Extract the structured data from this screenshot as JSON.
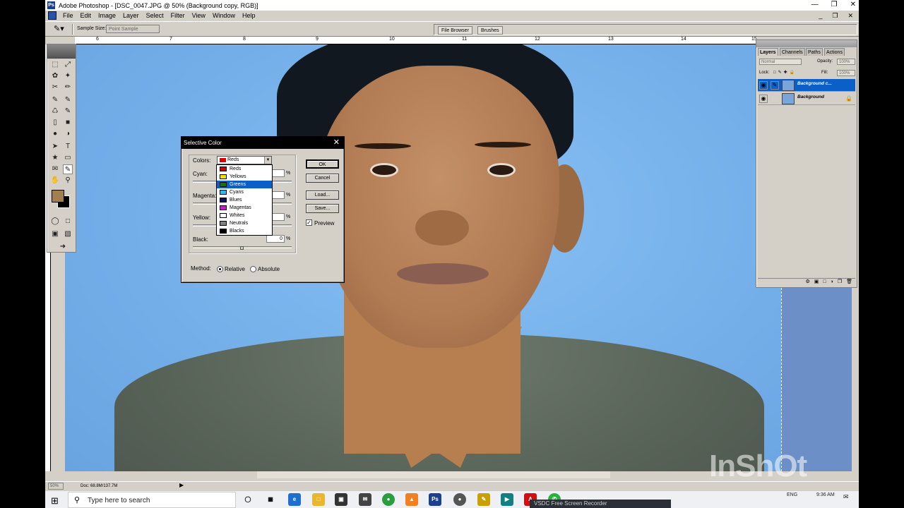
{
  "window": {
    "app_title": "Adobe Photoshop - [DSC_0047.JPG @ 50% (Background copy, RGB)]"
  },
  "menubar": {
    "items": [
      "File",
      "Edit",
      "Image",
      "Layer",
      "Select",
      "Filter",
      "View",
      "Window",
      "Help"
    ]
  },
  "options_bar": {
    "sample_size_label": "Sample Size:",
    "sample_size_value": "Point Sample",
    "palette_tabs": [
      "File Browser",
      "Brushes"
    ]
  },
  "ruler": {
    "ticks": [
      "6",
      "7",
      "8",
      "9",
      "10",
      "11",
      "12",
      "13",
      "14",
      "15"
    ]
  },
  "dialog": {
    "title": "Selective Color",
    "colors_label": "Colors:",
    "colors_selected": "Reds",
    "cyan_label": "Cyan:",
    "magenta_label": "Magenta:",
    "yellow_label": "Yellow:",
    "black_label": "Black:",
    "black_value": "0",
    "percent": "%",
    "ok_label": "OK",
    "cancel_label": "Cancel",
    "load_label": "Load...",
    "save_label": "Save...",
    "preview_label": "Preview",
    "preview_checked": true,
    "method_label": "Method:",
    "relative_label": "Relative",
    "absolute_label": "Absolute",
    "method_selected": "Relative"
  },
  "dropdown": {
    "options": [
      {
        "label": "Reds",
        "color": "#d40000"
      },
      {
        "label": "Yellows",
        "color": "#f0e000"
      },
      {
        "label": "Greens",
        "color": "#0a7a0a"
      },
      {
        "label": "Cyans",
        "color": "#30b8f0"
      },
      {
        "label": "Blues",
        "color": "#101060"
      },
      {
        "label": "Magentas",
        "color": "#c020c0"
      },
      {
        "label": "Whites",
        "color": "#ffffff"
      },
      {
        "label": "Neutrals",
        "color": "#808080"
      },
      {
        "label": "Blacks",
        "color": "#000000"
      }
    ],
    "highlighted": "Greens"
  },
  "layers_palette": {
    "tabs": [
      "Layers",
      "Channels",
      "Paths",
      "Actions"
    ],
    "blend_mode": "Normal",
    "opacity_label": "Opacity:",
    "opacity_value": "100%",
    "lock_label": "Lock:",
    "fill_label": "Fill:",
    "fill_value": "100%",
    "layers": [
      {
        "name": "Background c...",
        "active": true
      },
      {
        "name": "Background",
        "active": false
      }
    ]
  },
  "statusbar": {
    "zoom": "50%",
    "doc_info": "Doc: 68.8M/137.7M"
  },
  "taskbar": {
    "search_placeholder": "Type here to search",
    "language": "ENG",
    "time": "9:36 AM",
    "recorder_label": "VSDC Free Screen Recorder"
  },
  "watermark": "InShOt"
}
